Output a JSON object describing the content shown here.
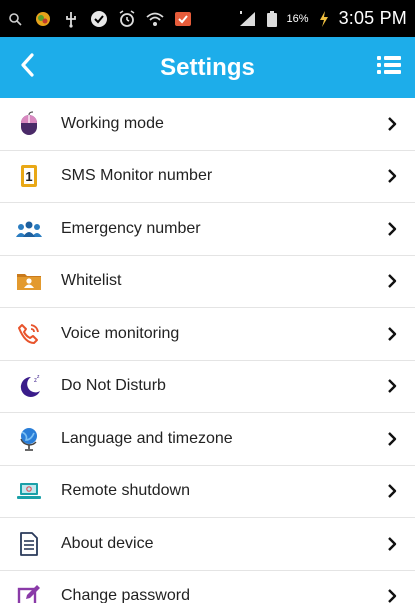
{
  "status_bar": {
    "battery_percent": "16%",
    "time": "3:05 PM",
    "icons": [
      "search-icon",
      "app-icon",
      "usb-icon",
      "check-icon",
      "alarm-icon",
      "wifi-icon",
      "notification-icon",
      "signal-icon",
      "battery-icon",
      "charging-icon"
    ]
  },
  "header": {
    "title": "Settings",
    "back_icon": "chevron-left-icon",
    "menu_icon": "list-menu-icon",
    "color": "#1dadea"
  },
  "settings": {
    "items": [
      {
        "label": "Working mode",
        "icon": "mouse-icon"
      },
      {
        "label": "SMS Monitor number",
        "icon": "sim-number-icon"
      },
      {
        "label": "Emergency number",
        "icon": "group-icon"
      },
      {
        "label": "Whitelist",
        "icon": "contact-folder-icon"
      },
      {
        "label": "Voice monitoring",
        "icon": "phone-call-icon"
      },
      {
        "label": "Do Not Disturb",
        "icon": "moon-icon"
      },
      {
        "label": "Language and timezone",
        "icon": "globe-icon"
      },
      {
        "label": "Remote shutdown",
        "icon": "laptop-icon"
      },
      {
        "label": "About device",
        "icon": "document-icon"
      },
      {
        "label": "Change password",
        "icon": "edit-icon"
      }
    ]
  }
}
